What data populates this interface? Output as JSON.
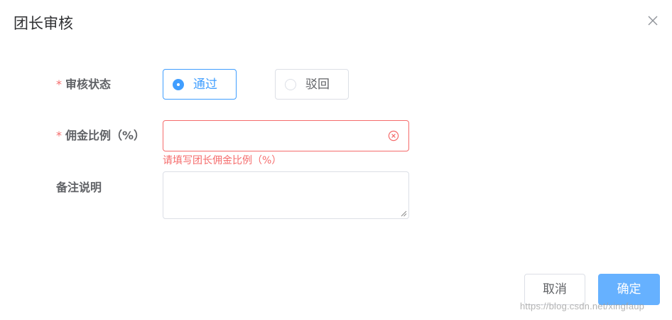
{
  "dialog": {
    "title": "团长审核",
    "close_icon": "close-icon"
  },
  "form": {
    "status": {
      "required_mark": "*",
      "label": "审核状态",
      "options": [
        {
          "label": "通过",
          "checked": true
        },
        {
          "label": "驳回",
          "checked": false
        }
      ]
    },
    "commission": {
      "required_mark": "*",
      "label": "佣金比例（%）",
      "value": "",
      "error": "请填写团长佣金比例（%）",
      "clear_icon": "circle-close-icon"
    },
    "remark": {
      "label": "备注说明",
      "value": ""
    }
  },
  "footer": {
    "cancel_label": "取消",
    "confirm_label": "确定"
  },
  "watermark": "https://blog.csdn.net/xingfaup",
  "colors": {
    "primary": "#409eff",
    "primary_light": "#66b1ff",
    "danger": "#f56c6c",
    "text": "#606266",
    "title": "#303133",
    "border": "#dcdfe6"
  }
}
